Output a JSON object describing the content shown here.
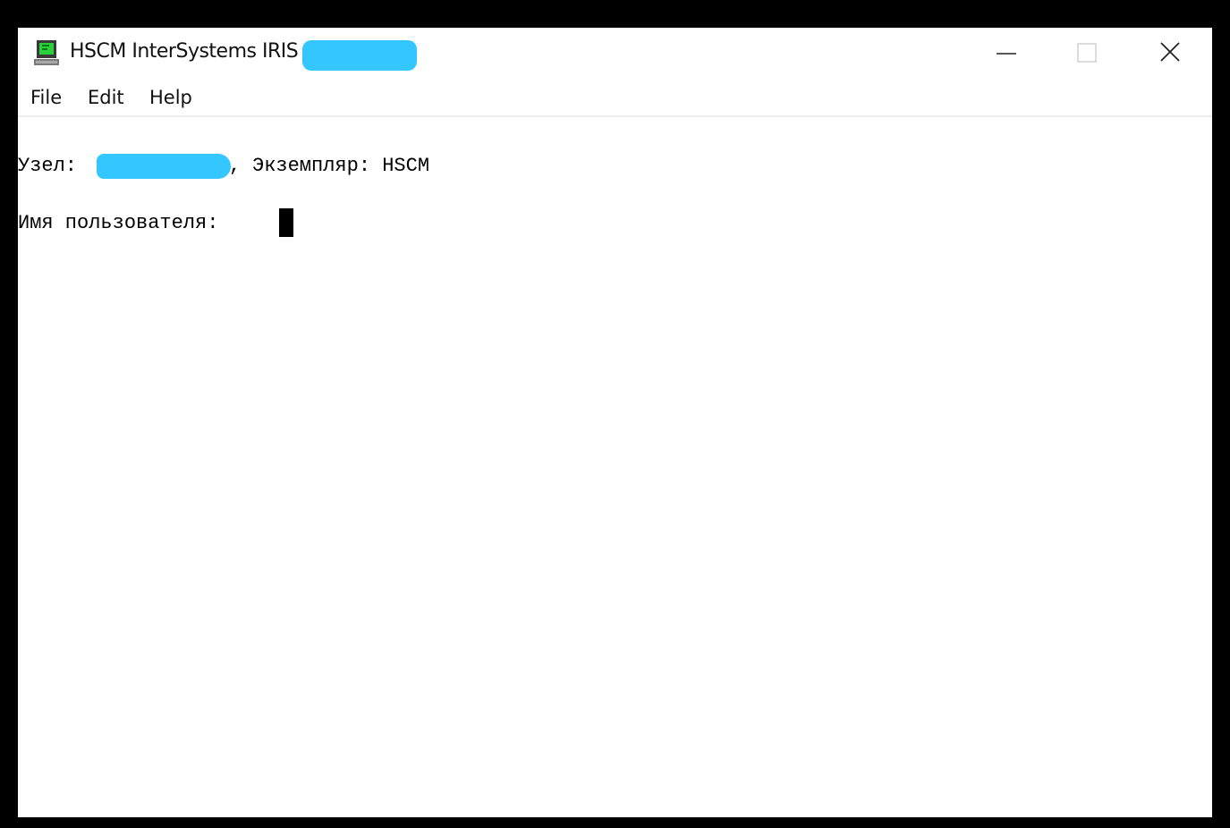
{
  "window": {
    "title": "HSCM InterSystems IRIS",
    "controls": {
      "minimize": "minimize",
      "maximize": "maximize",
      "close": "close"
    }
  },
  "menu": {
    "items": [
      {
        "label": "File"
      },
      {
        "label": "Edit"
      },
      {
        "label": "Help"
      }
    ]
  },
  "terminal": {
    "node_label": "Узел:",
    "instance_text": "Экземпляр: HSCM",
    "username_prompt": "Имя пользователя:"
  },
  "colors": {
    "redaction": "#33c6ff",
    "frame": "#000000",
    "background": "#ffffff"
  },
  "icons": {
    "app": "computer-terminal-icon"
  }
}
